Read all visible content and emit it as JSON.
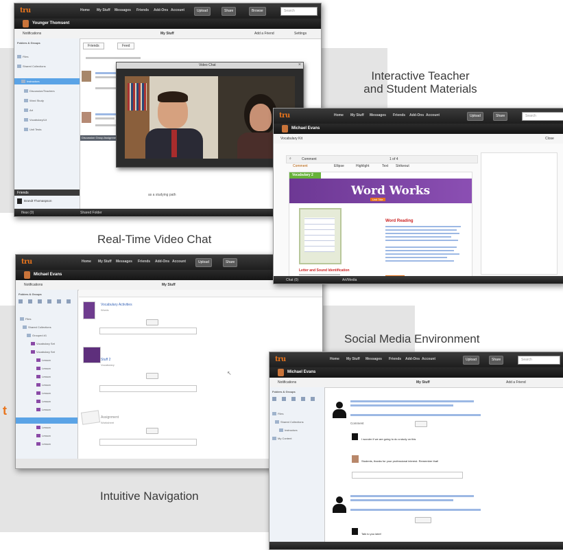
{
  "captions": {
    "interactive_line1": "Interactive Teacher",
    "interactive_line2": "and Student Materials",
    "video_chat": "Real-Time Video Chat",
    "social_media": "Social Media Environment",
    "navigation": "Intuitive Navigation",
    "edge_fragment": "t"
  },
  "app": {
    "logo": "tru",
    "nav": [
      "Home",
      "My Stuff",
      "Messages",
      "Friends",
      "Add-Ons",
      "Account"
    ],
    "upload_label": "Upload",
    "share_label": "Share",
    "browse_label": "Browse",
    "search_placeholder": "Search"
  },
  "screen_video": {
    "user_name": "Younger Thomsent",
    "toolbar_left": "Notifications",
    "toolbar_title": "My Stuff",
    "toolbar_right": "Add a Friend",
    "toolbar_right2": "Settings",
    "sidebar_header": "Folders & Groups",
    "tree": [
      "Files",
      "Shared Collections",
      "Instructors",
      "Discussion/Teachers",
      "Word Study",
      "Art",
      "Vocabulary/Lit",
      "Unit Tests"
    ],
    "tab1": "Friends",
    "tab2": "Feed",
    "chat_window_title": "Video Chat",
    "chat_label": "Discussion Group Assignment",
    "friend_label": "Friends",
    "friend_name": "Brandt Thomaspson",
    "bottom_left": "Ifeax (0)",
    "bottom_mid": "Shared Folder",
    "status_text": "as a studying path"
  },
  "screen_materials": {
    "user_name": "Michael Evans",
    "toolbar_left": "Vocabulary Kit",
    "toolbar_right": "Close",
    "comment_label": "Comment",
    "page_label": "1 of 4",
    "toolbar_items": [
      "Comment",
      "Ellipse",
      "Highlight",
      "Text",
      "Strikeout"
    ],
    "unit_label": "Vocabulary 2",
    "page_title": "Word Works",
    "page_badge": "Unit Title",
    "section1_title": "Word Reading",
    "section2_title": "Letter and Sound Identification",
    "bottom_left": "Chat (0)",
    "bottom_mid": "Art/Media"
  },
  "screen_nav": {
    "user_name": "Michael Evans",
    "toolbar_left": "Notifications",
    "toolbar_title": "My Stuff",
    "sidebar_header": "Folders & Groups",
    "tree": [
      "Files",
      "Shared Collections",
      "Grouped #1",
      "Vocabulary Set",
      "Vocabulary Set",
      "Lesson",
      "Lesson",
      "Lesson",
      "Lesson",
      "Lesson",
      "Lesson",
      "Lesson",
      "Lesson",
      "Lesson",
      "Lesson"
    ],
    "content_items": [
      "Vocabulary Activities",
      "Stuff 2",
      "Assignment"
    ],
    "content_subs": [
      "Words",
      "Vocabulary",
      "Worksheet"
    ]
  },
  "screen_social": {
    "user_name": "Michael Evans",
    "toolbar_left": "Notifications",
    "toolbar_title": "My Stuff",
    "toolbar_right": "Add a Friend",
    "sidebar_header": "Folders & Groups",
    "tree": [
      "Files",
      "Shared Collections",
      "Instructors",
      "My Content"
    ],
    "reply1": "I wonder if we are going to do a study on this",
    "reply2": "Students, thanks for your professional interest. Remember that!",
    "reply3": "Talk to you later!",
    "post_action": "Comment"
  },
  "colors": {
    "brand_orange": "#e8741c",
    "topbar": "#2a2a2a",
    "selection_blue": "#5aa3e6",
    "purple_header": "#7a3fa0",
    "green_tab": "#67b23a"
  }
}
